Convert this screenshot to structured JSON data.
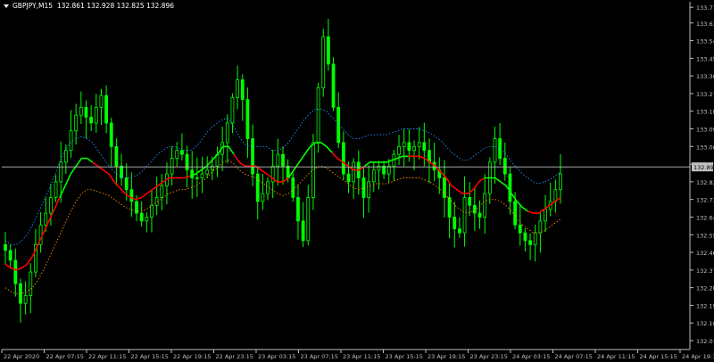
{
  "header": {
    "symbol": "GBPJPY,M15",
    "ohlc": "132.861 132.928 132.825 132.896"
  },
  "chart_data": {
    "type": "candlestick",
    "symbol": "GBPJPY",
    "timeframe": "M15",
    "current_price": "132.896",
    "ylim": [
      132.01,
      133.72
    ],
    "y_ticks": [
      "133.710",
      "133.630",
      "133.540",
      "133.450",
      "133.360",
      "133.270",
      "133.180",
      "133.090",
      "133.000",
      "132.910",
      "132.820",
      "132.730",
      "132.640",
      "132.550",
      "132.460",
      "132.370",
      "132.280",
      "132.190",
      "132.100",
      "132.010"
    ],
    "x_ticks": [
      "22 Apr 2020",
      "22 Apr 07:15",
      "22 Apr 11:15",
      "22 Apr 15:15",
      "22 Apr 19:15",
      "22 Apr 23:15",
      "23 Apr 03:15",
      "23 Apr 07:15",
      "23 Apr 11:15",
      "23 Apr 15:15",
      "23 Apr 19:15",
      "23 Apr 23:15",
      "24 Apr 03:15",
      "24 Apr 07:15",
      "24 Apr 11:15",
      "24 Apr 15:15",
      "24 Apr 19:15"
    ],
    "close": [
      132.47,
      132.42,
      132.3,
      132.2,
      132.24,
      132.36,
      132.5,
      132.6,
      132.66,
      132.74,
      132.82,
      132.92,
      132.98,
      133.08,
      133.16,
      133.2,
      133.15,
      133.12,
      133.2,
      133.26,
      133.12,
      133.0,
      132.9,
      132.84,
      132.78,
      132.72,
      132.66,
      132.62,
      132.64,
      132.7,
      132.74,
      132.8,
      132.86,
      132.94,
      132.98,
      132.96,
      132.88,
      132.84,
      132.84,
      132.86,
      132.88,
      132.9,
      132.96,
      133.02,
      133.12,
      133.25,
      133.34,
      133.24,
      133.04,
      132.86,
      132.72,
      132.76,
      132.82,
      132.9,
      132.96,
      132.9,
      132.84,
      132.74,
      132.62,
      132.52,
      132.74,
      133.02,
      133.3,
      133.56,
      133.42,
      133.2,
      133.02,
      132.86,
      132.82,
      132.92,
      132.84,
      132.74,
      132.82,
      132.88,
      132.9,
      132.86,
      132.9,
      132.96,
      133.0,
      133.02,
      132.98,
      133.0,
      133.02,
      132.98,
      132.92,
      132.88,
      132.84,
      132.74,
      132.64,
      132.58,
      132.56,
      132.74,
      132.7,
      132.66,
      132.64,
      132.76,
      132.92,
      133.04,
      132.94,
      132.86,
      132.72,
      132.6,
      132.56,
      132.52,
      132.5,
      132.56,
      132.62,
      132.68,
      132.72,
      132.78,
      132.86
    ],
    "ma_solid": [
      132.4,
      132.38,
      132.37,
      132.38,
      132.4,
      132.44,
      132.5,
      132.56,
      132.62,
      132.68,
      132.74,
      132.8,
      132.86,
      132.9,
      132.94,
      132.94,
      132.92,
      132.9,
      132.88,
      132.86,
      132.82,
      132.79,
      132.76,
      132.74,
      132.73,
      132.74,
      132.76,
      132.78,
      132.8,
      132.82,
      132.84,
      132.84,
      132.84,
      132.84,
      132.85,
      132.86,
      132.88,
      132.9,
      132.93,
      132.96,
      133.0,
      133.0,
      132.96,
      132.92,
      132.9,
      132.9,
      132.9,
      132.88,
      132.86,
      132.84,
      132.82,
      132.82,
      132.84,
      132.88,
      132.92,
      132.96,
      133.0,
      133.02,
      133.02,
      133.0,
      132.97,
      132.94,
      132.92,
      132.9,
      132.88,
      132.88,
      132.9,
      132.92,
      132.92,
      132.92,
      132.92,
      132.93,
      132.94,
      132.95,
      132.95,
      132.95,
      132.95,
      132.94,
      132.92,
      132.9,
      132.87,
      132.84,
      132.8,
      132.78,
      132.76,
      132.76,
      132.78,
      132.82,
      132.84,
      132.84,
      132.84,
      132.82,
      132.8,
      132.76,
      132.72,
      132.69,
      132.67,
      132.66,
      132.66,
      132.68,
      132.7,
      132.72,
      132.74
    ],
    "ma_solid_ranges": [
      [
        0,
        10,
        "#ff0000"
      ],
      [
        10,
        16,
        "#00ff00"
      ],
      [
        16,
        34,
        "#ff0000"
      ],
      [
        34,
        42,
        "#00ff00"
      ],
      [
        42,
        52,
        "#ff0000"
      ],
      [
        52,
        60,
        "#00ff00"
      ],
      [
        60,
        66,
        "#ff0000"
      ],
      [
        66,
        74,
        "#00ff00"
      ],
      [
        74,
        88,
        "#ff0000"
      ],
      [
        88,
        96,
        "#00ff00"
      ],
      [
        96,
        102,
        "#ff0000"
      ],
      [
        102,
        108,
        "#00ff00"
      ]
    ],
    "ma_dotted_upper": [
      132.52,
      132.5,
      132.5,
      132.52,
      132.55,
      132.6,
      132.66,
      132.72,
      132.78,
      132.85,
      132.92,
      132.98,
      133.02,
      133.04,
      133.05,
      133.04,
      133.02,
      132.98,
      132.94,
      132.9,
      132.87,
      132.85,
      132.84,
      132.84,
      132.85,
      132.87,
      132.9,
      132.93,
      132.96,
      132.98,
      133.0,
      133.0,
      132.99,
      132.98,
      132.98,
      133.0,
      133.03,
      133.07,
      133.1,
      133.12,
      133.14,
      133.14,
      133.1,
      133.05,
      133.01,
      133.0,
      133.0,
      133.0,
      133.0,
      132.98,
      132.98,
      132.99,
      133.02,
      133.06,
      133.1,
      133.14,
      133.17,
      133.19,
      133.19,
      133.18,
      133.15,
      133.12,
      133.09,
      133.06,
      133.04,
      133.04,
      133.05,
      133.06,
      133.06,
      133.06,
      133.06,
      133.07,
      133.08,
      133.09,
      133.09,
      133.09,
      133.09,
      133.08,
      133.07,
      133.05,
      133.03,
      133.0,
      132.97,
      132.95,
      132.93,
      132.93,
      132.95,
      132.97,
      132.99,
      133.0,
      133.0,
      132.99,
      132.96,
      132.92,
      132.89,
      132.86,
      132.84,
      132.82,
      132.81,
      132.82,
      132.83,
      132.85,
      132.87
    ],
    "ma_dotted_lower": [
      132.28,
      132.26,
      132.25,
      132.25,
      132.26,
      132.28,
      132.32,
      132.37,
      132.43,
      132.49,
      132.55,
      132.61,
      132.67,
      132.72,
      132.76,
      132.78,
      132.78,
      132.77,
      132.76,
      132.75,
      132.73,
      132.71,
      132.69,
      132.68,
      132.67,
      132.67,
      132.68,
      132.7,
      132.72,
      132.74,
      132.76,
      132.77,
      132.78,
      132.78,
      132.79,
      132.8,
      132.82,
      132.84,
      132.87,
      132.89,
      132.92,
      132.93,
      132.91,
      132.88,
      132.86,
      132.85,
      132.84,
      132.82,
      132.8,
      132.78,
      132.76,
      132.75,
      132.76,
      132.78,
      132.81,
      132.84,
      132.87,
      132.89,
      132.9,
      132.89,
      132.87,
      132.85,
      132.83,
      132.81,
      132.79,
      132.78,
      132.79,
      132.8,
      132.81,
      132.81,
      132.81,
      132.82,
      132.83,
      132.84,
      132.84,
      132.84,
      132.84,
      132.83,
      132.82,
      132.8,
      132.78,
      132.75,
      132.72,
      132.69,
      132.67,
      132.66,
      132.67,
      132.69,
      132.72,
      132.73,
      132.73,
      132.72,
      132.7,
      132.67,
      132.63,
      132.6,
      132.58,
      132.56,
      132.56,
      132.57,
      132.59,
      132.61,
      132.63
    ],
    "colors": {
      "background": "#000000",
      "candle": "#00ff00",
      "grid_text": "#c0c0c0",
      "price_line": "#c0c0c0",
      "ma_fast": "#ff0000",
      "ma_slow": "#00ff00",
      "band_upper": "#1e90ff",
      "band_lower": "#ff8c00"
    }
  }
}
